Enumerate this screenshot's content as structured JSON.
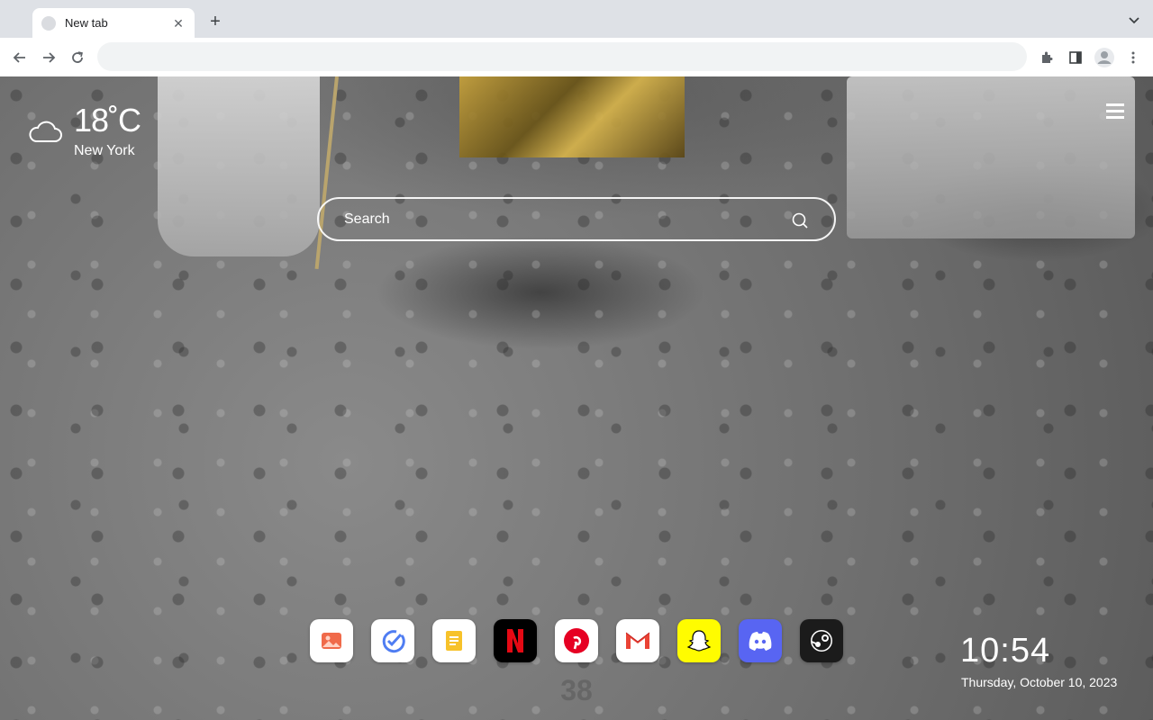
{
  "browser": {
    "tab": {
      "title": "New tab",
      "close": "✕"
    },
    "new_tab": "+",
    "omnibox_value": ""
  },
  "weather": {
    "temperature": "18˚C",
    "city": "New York",
    "icon": "cloud-icon"
  },
  "search": {
    "placeholder": "Search"
  },
  "apps": [
    {
      "name": "photos",
      "color": "#ffffff"
    },
    {
      "name": "checklist",
      "color": "#ffffff"
    },
    {
      "name": "notes",
      "color": "#ffffff"
    },
    {
      "name": "netflix",
      "color": "#000000"
    },
    {
      "name": "pinterest",
      "color": "#ffffff"
    },
    {
      "name": "gmail",
      "color": "#ffffff"
    },
    {
      "name": "snapchat",
      "color": "#fffc00"
    },
    {
      "name": "discord",
      "color": "#5865f2"
    },
    {
      "name": "steam",
      "color": "#1b1b1b"
    }
  ],
  "page_number": "38",
  "clock": {
    "time": "10:54",
    "date": "Thursday, October 10, 2023"
  }
}
